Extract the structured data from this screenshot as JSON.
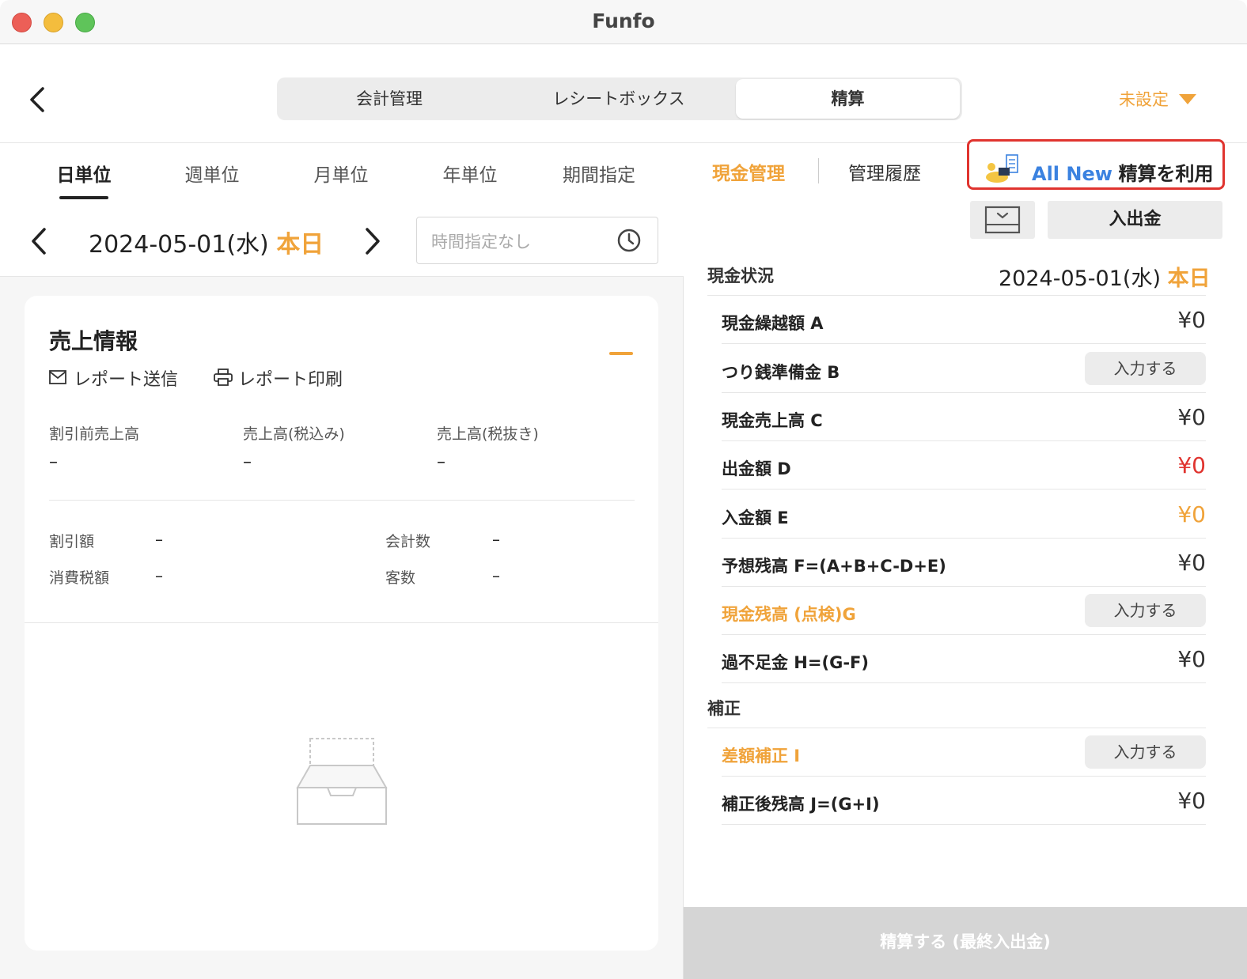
{
  "window": {
    "title": "Funfo"
  },
  "nav": {
    "segments": [
      "会計管理",
      "レシートボックス",
      "精算"
    ],
    "active_segment": "精算",
    "unset_label": "未設定"
  },
  "period_tabs": [
    "日単位",
    "週単位",
    "月単位",
    "年単位",
    "期間指定"
  ],
  "date_nav": {
    "date": "2024-05-01(水)",
    "today": "本日",
    "time_placeholder": "時間指定なし"
  },
  "sales": {
    "title": "売上情報",
    "report_send": "レポート送信",
    "report_print": "レポート印刷",
    "metrics": [
      {
        "label": "割引前売上高",
        "value": "–"
      },
      {
        "label": "売上高(税込み)",
        "value": "–"
      },
      {
        "label": "売上高(税抜き)",
        "value": "–"
      }
    ],
    "stats": [
      {
        "label": "割引額",
        "value": "–"
      },
      {
        "label": "会計数",
        "value": "–"
      },
      {
        "label": "消費税額",
        "value": "–"
      },
      {
        "label": "客数",
        "value": "–"
      }
    ]
  },
  "right": {
    "tabs": [
      "現金管理",
      "管理履歴"
    ],
    "active_tab": "現金管理",
    "all_new": "All New",
    "use_settlement": "精算を利用",
    "deposit_button": "入出金",
    "cash_status_label": "現金状況",
    "cash_date": "2024-05-01(水)",
    "cash_today": "本日",
    "input_label": "入力する",
    "rows": [
      {
        "label": "現金繰越額 A",
        "value": "¥0"
      },
      {
        "label": "つり銭準備金 B",
        "value": ""
      },
      {
        "label": "現金売上高 C",
        "value": "¥0"
      },
      {
        "label": "出金額 D",
        "value": "¥0"
      },
      {
        "label": "入金額 E",
        "value": "¥0"
      },
      {
        "label": "予想残高 F=(A+B+C-D+E)",
        "value": "¥0"
      },
      {
        "label": "現金残高 (点検)G",
        "value": ""
      },
      {
        "label": "過不足金 H=(G-F)",
        "value": "¥0"
      }
    ],
    "correction_label": "補正",
    "correction_rows": [
      {
        "label": "差額補正 I",
        "value": ""
      },
      {
        "label": "補正後残高 J=(G+I)",
        "value": "¥0"
      }
    ],
    "settle_button": "精算する (最終入出金)"
  },
  "colors": {
    "accent": "#f0a33a",
    "red": "#e0342f",
    "blue": "#3b82e0"
  }
}
